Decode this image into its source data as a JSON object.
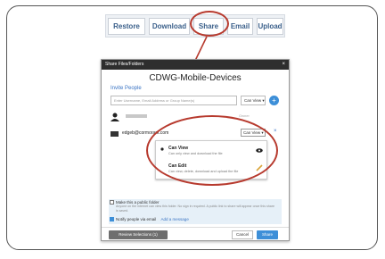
{
  "toolbar": {
    "buttons": [
      "Restore",
      "Download",
      "Share",
      "Email",
      "Upload"
    ]
  },
  "dialog": {
    "header": "Share Files/Folders",
    "close_glyph": "×",
    "title": "CDWG-Mobile-Devices",
    "invite_label": "Invite People",
    "search_placeholder": "Enter Username, Email Address or Group Name(s)",
    "permission_select": "Can View ▾",
    "add_glyph": "+",
    "owner_label": "Owner",
    "recipient_email": "edgeb@cormorant.com",
    "recipient_permission": "Can View ▾",
    "remove_glyph": "×",
    "permissions": [
      {
        "title": "Can View",
        "desc": "Can only view and download the file"
      },
      {
        "title": "Can Edit",
        "desc": "Can view, delete, download and upload the file"
      }
    ],
    "public_folder": {
      "label": "Make this a public folder",
      "desc": "Anyone on the internet can view this folder. No sign in required. A public link to share will appear once this share is saved."
    },
    "notify": {
      "label": "Notify people via email",
      "link": "Add a message"
    },
    "buttons": {
      "review": "Review Selections (1)",
      "cancel": "Cancel",
      "share": "Share"
    }
  },
  "colors": {
    "accent": "#3d8fd8",
    "annotation": "#b73a2e",
    "header": "#2e2e2e"
  }
}
